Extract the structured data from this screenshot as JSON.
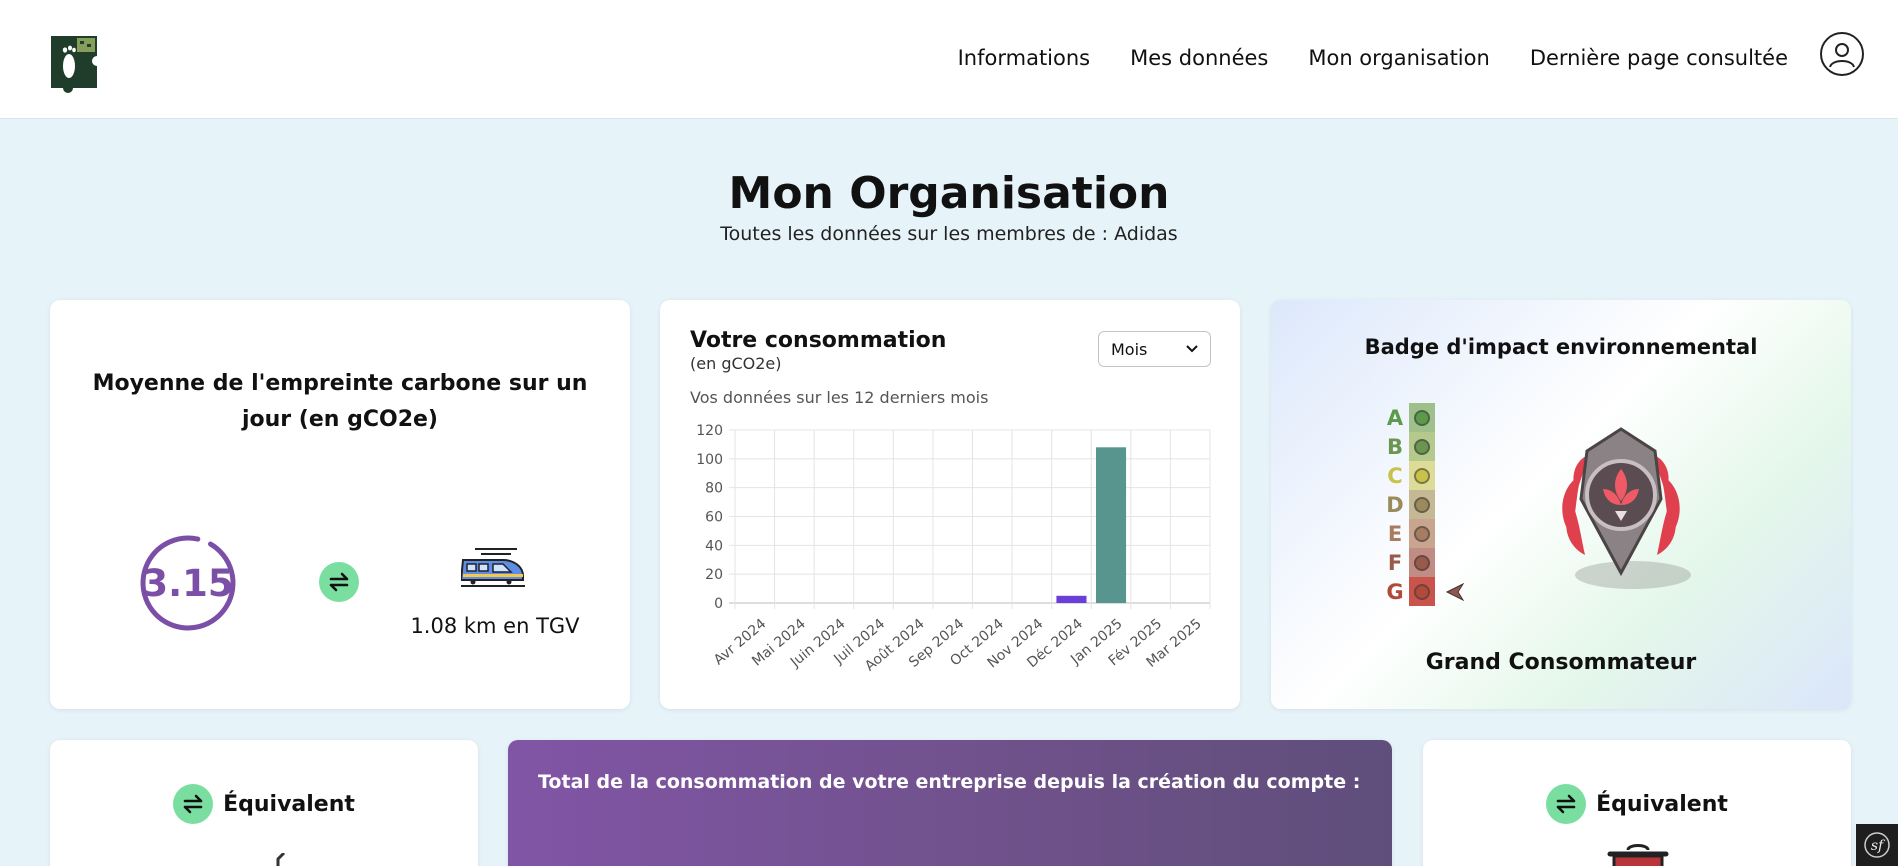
{
  "header": {
    "logo_icon": "footprint-puzzle-logo",
    "nav": [
      {
        "label": "Informations"
      },
      {
        "label": "Mes données"
      },
      {
        "label": "Mon organisation"
      },
      {
        "label": "Dernière page consultée"
      }
    ],
    "user_icon": "user-circle-icon"
  },
  "page": {
    "title": "Mon Organisation",
    "subtitle": "Toutes les données sur les membres de : Adidas"
  },
  "average_card": {
    "title": "Moyenne de l'empreinte carbone sur un jour (en gCO2e)",
    "value": "3.15",
    "ring_fraction": 0.95,
    "ring_color": "#7b4fa6",
    "equivalent_icon": "high-speed-train-icon",
    "equivalent_text": "1.08 km en TGV"
  },
  "consumption_card": {
    "title": "Votre consommation",
    "unit": "(en gCO2e)",
    "period_select": {
      "selected": "Mois"
    },
    "subtitle": "Vos données sur les 12 derniers mois"
  },
  "chart_data": {
    "type": "bar",
    "categories": [
      "Avr 2024",
      "Mai 2024",
      "Juin 2024",
      "Juil 2024",
      "Août 2024",
      "Sep 2024",
      "Oct 2024",
      "Nov 2024",
      "Déc 2024",
      "Jan 2025",
      "Fév 2025",
      "Mar 2025"
    ],
    "values": [
      0,
      0,
      0,
      0,
      0,
      0,
      0,
      0,
      5,
      108,
      0,
      0
    ],
    "bar_colors": [
      "#6a3fd9",
      "#6a3fd9",
      "#6a3fd9",
      "#6a3fd9",
      "#6a3fd9",
      "#6a3fd9",
      "#6a3fd9",
      "#6a3fd9",
      "#6a3fd9",
      "#58958e",
      "#58958e",
      "#58958e"
    ],
    "ylim": [
      0,
      120
    ],
    "yticks": [
      0,
      20,
      40,
      60,
      80,
      100,
      120
    ],
    "grid": true,
    "xlabel": "",
    "ylabel": "",
    "title": ""
  },
  "badge_card": {
    "title": "Badge d'impact environnemental",
    "scale": [
      {
        "letter": "A",
        "color": "#5a9a4a",
        "chip": "#9fc08a"
      },
      {
        "letter": "B",
        "color": "#6a9650",
        "chip": "#b6c98d"
      },
      {
        "letter": "C",
        "color": "#c9c24a",
        "chip": "#dcdc98"
      },
      {
        "letter": "D",
        "color": "#9b8a5a",
        "chip": "#c5b895"
      },
      {
        "letter": "E",
        "color": "#a67d60",
        "chip": "#c9a590"
      },
      {
        "letter": "F",
        "color": "#9a5a4a",
        "chip": "#c08c84"
      },
      {
        "letter": "G",
        "color": "#b24a3a",
        "chip": "#c8544c"
      }
    ],
    "current_grade": "G",
    "medal_icon": "red-laurel-medal-icon",
    "badge_name": "Grand Consommateur"
  },
  "bottom": {
    "equivalent_left": "Équivalent",
    "total_title": "Total de la consommation de votre entreprise depuis la création du compte :",
    "equivalent_right": "Équivalent"
  },
  "colors": {
    "page_bg": "#e6f3f9",
    "accent_green": "#79dea0",
    "accent_purple": "#7b4fa6",
    "total_card_start": "#8155a6",
    "total_card_end": "#5f4e7b"
  }
}
